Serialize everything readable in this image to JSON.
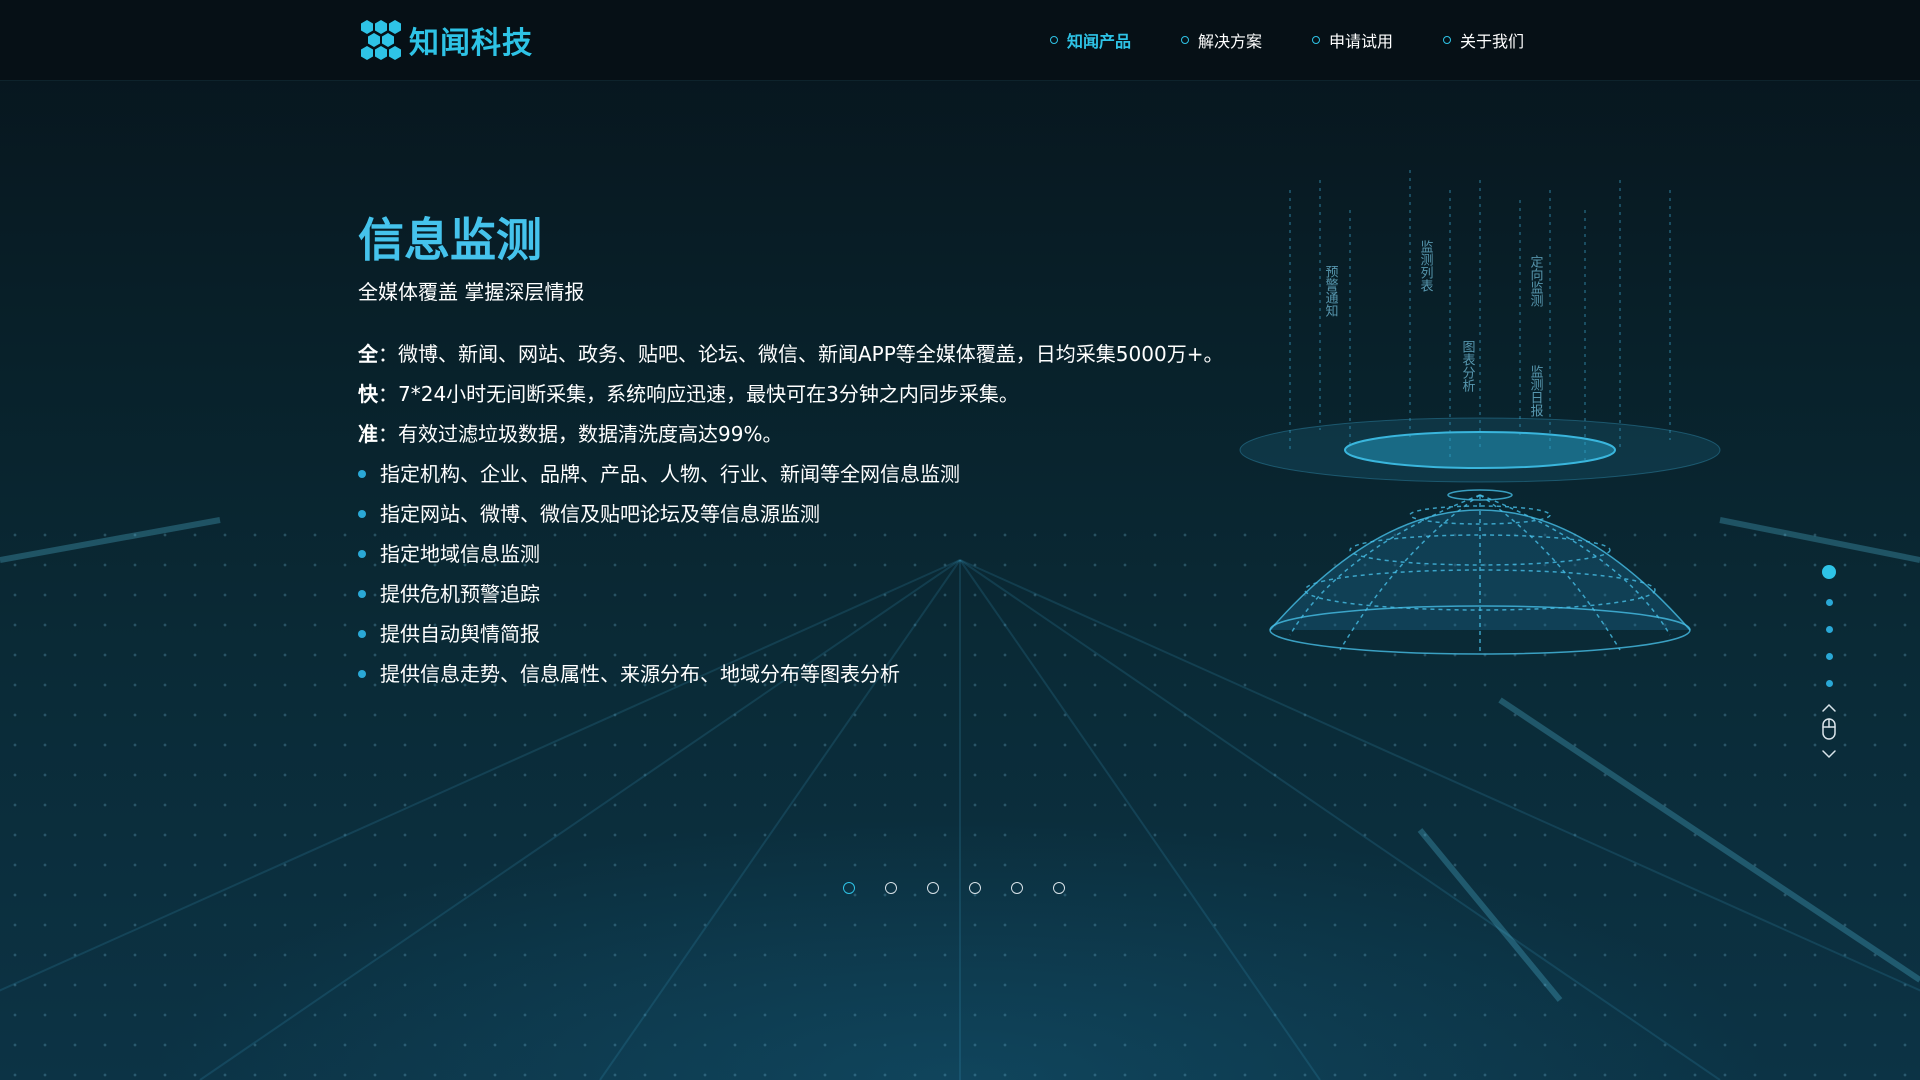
{
  "brand": {
    "name": "知闻科技"
  },
  "nav": {
    "items": [
      {
        "label": "知闻产品",
        "active": true
      },
      {
        "label": "解决方案",
        "active": false
      },
      {
        "label": "申请试用",
        "active": false
      },
      {
        "label": "关于我们",
        "active": false
      }
    ]
  },
  "hero": {
    "title": "信息监测",
    "subtitle": "全媒体覆盖 掌握深层情报",
    "features": [
      {
        "key": "全",
        "text": "：微博、新闻、网站、政务、贴吧、论坛、微信、新闻APP等全媒体覆盖，日均采集5000万+。"
      },
      {
        "key": "快",
        "text": "：7*24小时无间断采集，系统响应迅速，最快可在3分钟之内同步采集。"
      },
      {
        "key": "准",
        "text": "：有效过滤垃圾数据，数据清洗度高达99%。"
      }
    ],
    "bullets": [
      "指定机构、企业、品牌、产品、人物、行业、新闻等全网信息监测",
      "指定网站、微博、微信及贴吧论坛及等信息源监测",
      "指定地域信息监测",
      "提供危机预警追踪",
      "提供自动舆情简报",
      "提供信息走势、信息属性、来源分布、地域分布等图表分析"
    ]
  },
  "illustration": {
    "labels": [
      "预警通知",
      "监测列表",
      "图表分析",
      "定向监测",
      "监测日报"
    ]
  },
  "side_nav": {
    "count": 5,
    "active_index": 0
  },
  "pager": {
    "count": 6,
    "active_index": 0
  },
  "colors": {
    "accent": "#2ec3e6",
    "title": "#45c3ec",
    "bullet": "#2aa8d6",
    "background": "#0a2a36"
  }
}
